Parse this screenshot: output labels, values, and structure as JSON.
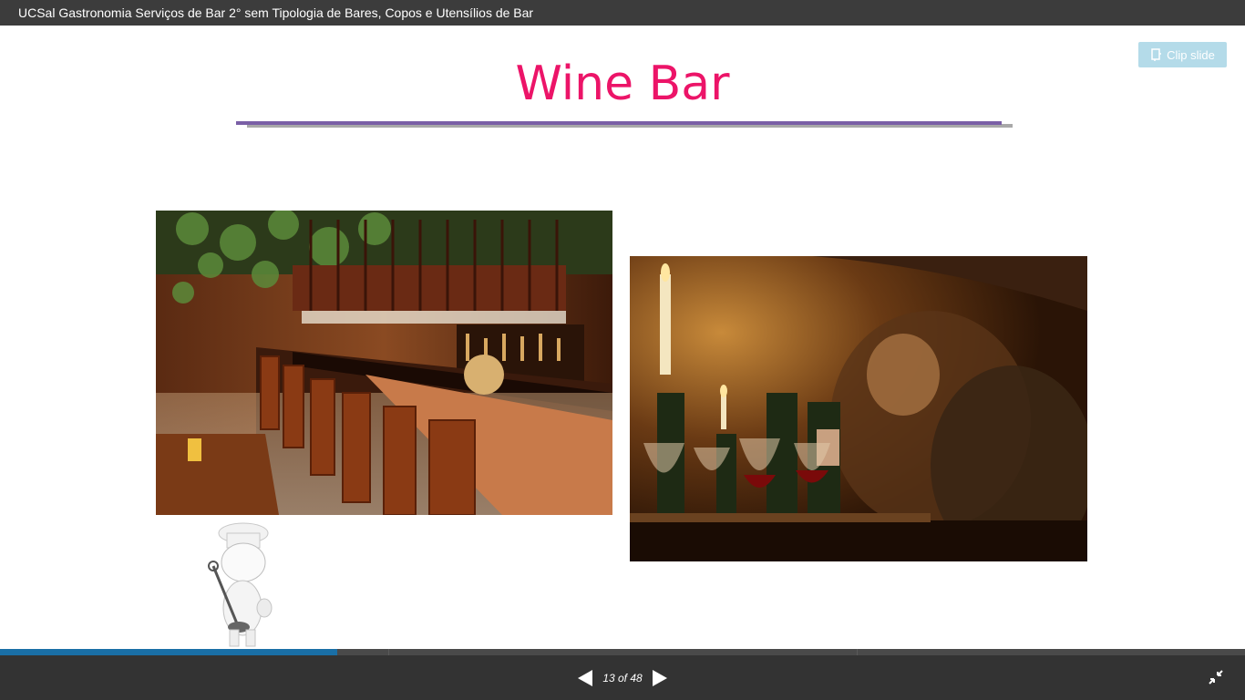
{
  "window": {
    "title": "UCSal Gastronomia Serviços de Bar 2° sem Tipologia de Bares, Copos e Utensílios de Bar"
  },
  "toolbar": {
    "clip_label": "Clip slide",
    "clip_icon": "clip-icon"
  },
  "slide": {
    "title": "Wine Bar",
    "title_color": "#ec1468",
    "rule_color": "#7a5fa6",
    "images": [
      {
        "name": "wine-bar-interior-photo",
        "kind": "photo"
      },
      {
        "name": "wine-cellar-table-photo",
        "kind": "photo"
      },
      {
        "name": "chef-figure-illustration",
        "kind": "clipart"
      }
    ]
  },
  "progress": {
    "current": 13,
    "total": 48,
    "fraction": 0.271,
    "fill_color": "#1a6fa6"
  },
  "controls": {
    "counter_text": "13 of 48",
    "prev_icon": "triangle-left-icon",
    "next_icon": "triangle-right-icon",
    "fullscreen_icon": "exit-fullscreen-icon"
  }
}
